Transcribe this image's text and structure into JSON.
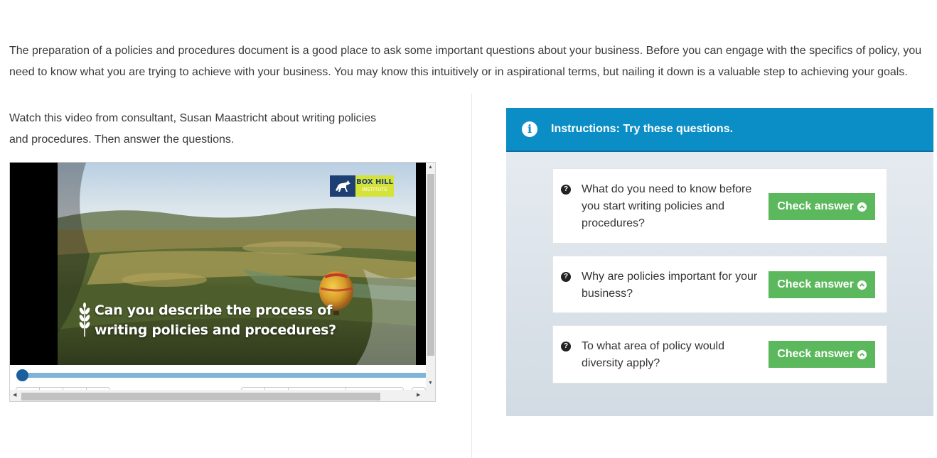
{
  "intro": {
    "text": "The preparation of a policies and procedures document is a good place to ask some important questions about your business. Before you can engage with the specifics of policy, you need to know what you are trying to achieve with your business. You may know this intuitively or in aspirational terms, but nailing it down is a valuable step to achieving your goals."
  },
  "left": {
    "instructions": "Watch this video from consultant, Susan Maastricht about writing policies and procedures. Then answer the questions."
  },
  "video": {
    "logo_line1": "BOX HILL",
    "logo_line2": "INSTITUTE",
    "caption_line1": "Can you describe the process of",
    "caption_line2": "writing policies and procedures?",
    "progress_fraction": 0.0
  },
  "panel": {
    "header_title": "Instructions: Try these questions.",
    "info_icon": "info-circle-icon",
    "questions": [
      {
        "text": "What do you need to know before you start writing policies and procedures?",
        "button": "Check answer"
      },
      {
        "text": "Why are policies important for your business?",
        "button": "Check answer"
      },
      {
        "text": "To what area of policy would diversity apply?",
        "button": "Check answer"
      }
    ]
  },
  "colors": {
    "header_blue": "#0b8ec6",
    "button_green": "#5cb85c",
    "progress_blue": "#7fb3d8"
  }
}
